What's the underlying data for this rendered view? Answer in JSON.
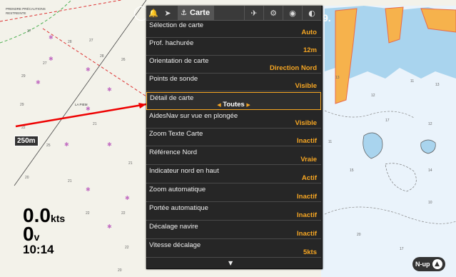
{
  "menu": {
    "title": "Carte",
    "icons": [
      "bell-icon",
      "navigate-icon",
      "chart-icon",
      "satellite-icon",
      "settings-icon",
      "eye-icon",
      "sonar-icon"
    ],
    "items": [
      {
        "label": "Sélection de carte",
        "value": "Auto"
      },
      {
        "label": "Prof. hachurée",
        "value": "12m"
      },
      {
        "label": "Orientation de carte",
        "value": "Direction Nord"
      },
      {
        "label": "Points de sonde",
        "value": "Visible"
      },
      {
        "label": "Détail de carte",
        "value": "Toutes"
      },
      {
        "label": "AidesNav sur vue en plongée",
        "value": "Visible"
      },
      {
        "label": "Zoom Texte Carte",
        "value": "Inactif"
      },
      {
        "label": "Référence Nord",
        "value": "Vraie"
      },
      {
        "label": "Indicateur nord en haut",
        "value": "Actif"
      },
      {
        "label": "Zoom automatique",
        "value": "Inactif"
      },
      {
        "label": "Portée automatique",
        "value": "Inactif"
      },
      {
        "label": "Décalage navire",
        "value": "Inactif"
      },
      {
        "label": "Vitesse décalage",
        "value": "5kts"
      }
    ]
  },
  "overlay": {
    "speed_value": "0.0",
    "speed_unit": "kts",
    "heading_value": "0",
    "heading_unit": "v",
    "time": "10:14",
    "scale": "250m",
    "orientation_label": "N-up",
    "depth_partial": "9.",
    "annotation": "LA PIEM"
  }
}
